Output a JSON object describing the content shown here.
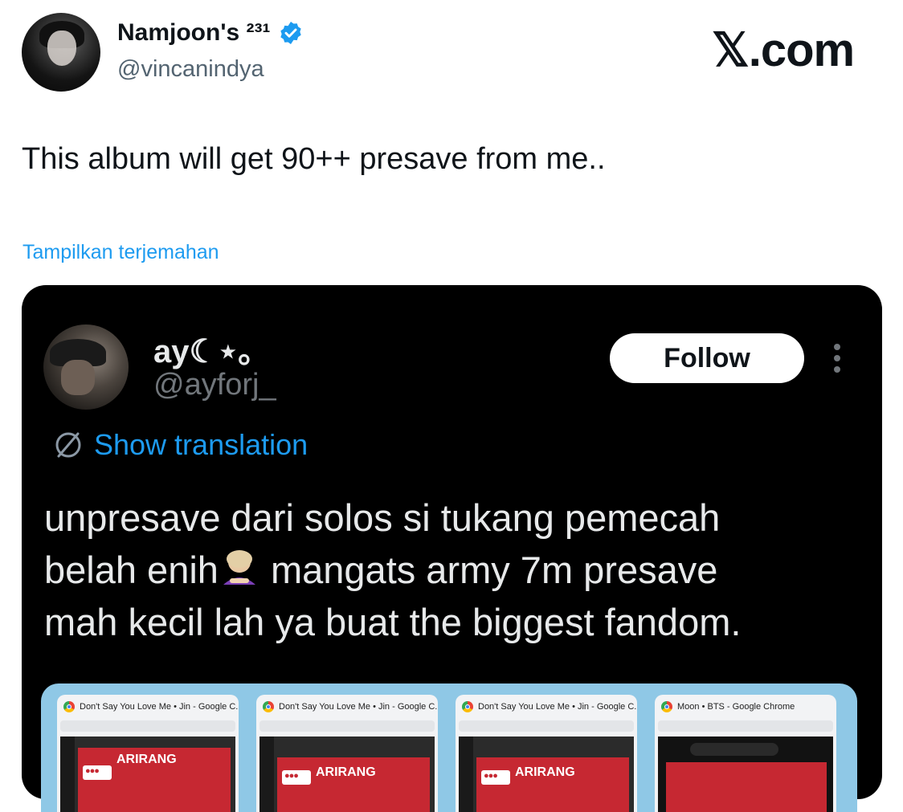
{
  "header": {
    "display_name": "Namjoon's ²³¹",
    "handle": "@vincanindya",
    "brand": "𝕏.com"
  },
  "tweet": {
    "text": "This album will get 90++ presave from me..",
    "translate_link": "Tampilkan terjemahan"
  },
  "quoted": {
    "name": "ay☾⋆｡",
    "handle": "@ayforj_",
    "follow_label": "Follow",
    "show_translation": "Show translation",
    "lines": [
      "unpresave dari solos si tukang pemecah",
      "belah enih",
      "mangats army 7m presave",
      "mah kecil lah ya buat the biggest fandom."
    ],
    "screenshots": [
      {
        "title": "Don't Say You Love Me • Jin - Google C...",
        "label": "ARIRANG"
      },
      {
        "title": "Don't Say You Love Me • Jin - Google C...",
        "label": "ARIRANG"
      },
      {
        "title": "Don't Say You Love Me • Jin - Google C...",
        "label": "ARIRANG"
      },
      {
        "title": "Moon • BTS - Google Chrome",
        "label": ""
      }
    ]
  },
  "colors": {
    "link_blue": "#1d9bf0",
    "verified_blue": "#1d9bf0",
    "embed_bg": "#000000",
    "album_red": "#c62832"
  },
  "icons": [
    "verified-badge-icon",
    "globe-slash-icon",
    "more-options-icon",
    "chrome-icon"
  ]
}
